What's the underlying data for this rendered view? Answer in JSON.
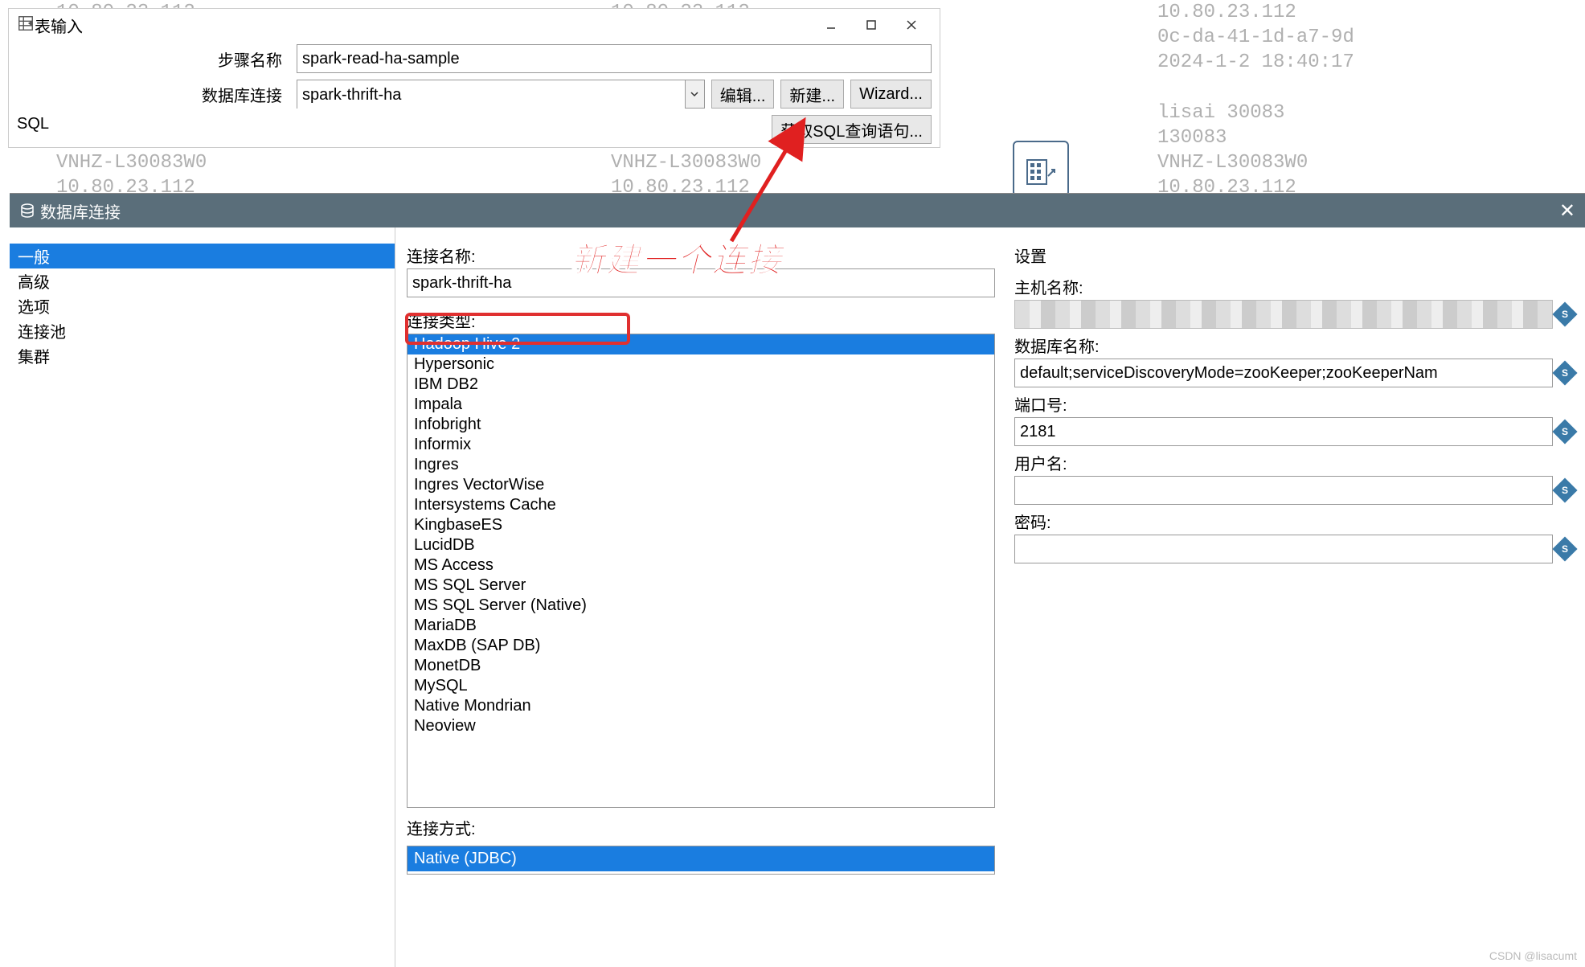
{
  "watermark_text": "10.80.23.112\n0c-da-41-1d-a7-9d\n2024-1-2 18:40:17\n\nlisai 30083\n130083\nVNHZ-L30083W0\n10.80.23.112\n0c-da-41-1d-a7-9d\n2024-1-2 18:40:17\n\nlisai 30083\n130083\nVNHZ-L30083W0\n10.80.23.112\n0c-da-41-1d-a7-9d\n2024-1-2 18:40:17\n\nlisai 30083\n130083\nVNHZ-L30083W0\n10.80.23.112",
  "top_window": {
    "title": "表输入",
    "step_name_label": "步骤名称",
    "step_name_value": "spark-read-ha-sample",
    "db_conn_label": "数据库连接",
    "db_conn_value": "spark-thrift-ha",
    "edit_btn": "编辑...",
    "new_btn": "新建...",
    "wizard_btn": "Wizard...",
    "sql_label": "SQL",
    "get_sql_btn": "获取SQL查询语句..."
  },
  "annotation": "新建一个连接",
  "db_window": {
    "title": "数据库连接",
    "sidebar": [
      "一般",
      "高级",
      "选项",
      "连接池",
      "集群"
    ],
    "conn_name_label": "连接名称:",
    "conn_name_value": "spark-thrift-ha",
    "conn_type_label": "连接类型:",
    "conn_types": [
      "Hadoop Hive 2",
      "Hypersonic",
      "IBM DB2",
      "Impala",
      "Infobright",
      "Informix",
      "Ingres",
      "Ingres VectorWise",
      "Intersystems Cache",
      "KingbaseES",
      "LucidDB",
      "MS Access",
      "MS SQL Server",
      "MS SQL Server (Native)",
      "MariaDB",
      "MaxDB (SAP DB)",
      "MonetDB",
      "MySQL",
      "Native Mondrian",
      "Neoview"
    ],
    "conn_method_label": "连接方式:",
    "conn_method_value": "Native (JDBC)",
    "settings_label": "设置",
    "host_label": "主机名称:",
    "dbname_label": "数据库名称:",
    "dbname_value": "default;serviceDiscoveryMode=zooKeeper;zooKeeperNam",
    "port_label": "端口号:",
    "port_value": "2181",
    "user_label": "用户名:",
    "user_value": "",
    "pass_label": "密码:",
    "pass_value": ""
  },
  "csdn": "CSDN @lisacumt"
}
